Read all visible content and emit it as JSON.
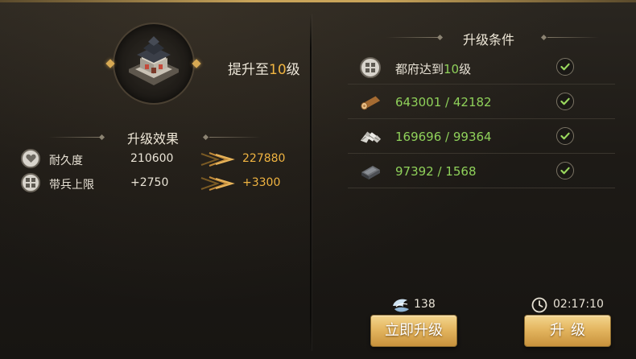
{
  "header": {
    "upgrade_prefix": "提升至",
    "upgrade_level": "10",
    "upgrade_suffix": "级"
  },
  "effects": {
    "title": "升级效果",
    "rows": [
      {
        "icon": "heart-icon",
        "name": "耐久度",
        "current": "210600",
        "next": "227880"
      },
      {
        "icon": "troops-grid-icon",
        "name": "带兵上限",
        "current": "+2750",
        "next": "+3300"
      }
    ]
  },
  "conditions": {
    "title": "升级条件",
    "rows": [
      {
        "icon": "building-grid-icon",
        "prefix": "都府达到",
        "highlight": "10",
        "suffix": "级",
        "met": true
      },
      {
        "icon": "wood-icon",
        "value": "643001 / 42182",
        "met": true
      },
      {
        "icon": "stone-icon",
        "value": "169696 / 99364",
        "met": true
      },
      {
        "icon": "iron-icon",
        "value": "97392 / 1568",
        "met": true
      }
    ]
  },
  "footer": {
    "cost_value": "138",
    "timer_value": "02:17:10",
    "instant_label": "立即升级",
    "upgrade_label": "升级"
  },
  "colors": {
    "highlight": "#f0b441",
    "green": "#8fd15a",
    "button_gold": "#e4b660"
  }
}
